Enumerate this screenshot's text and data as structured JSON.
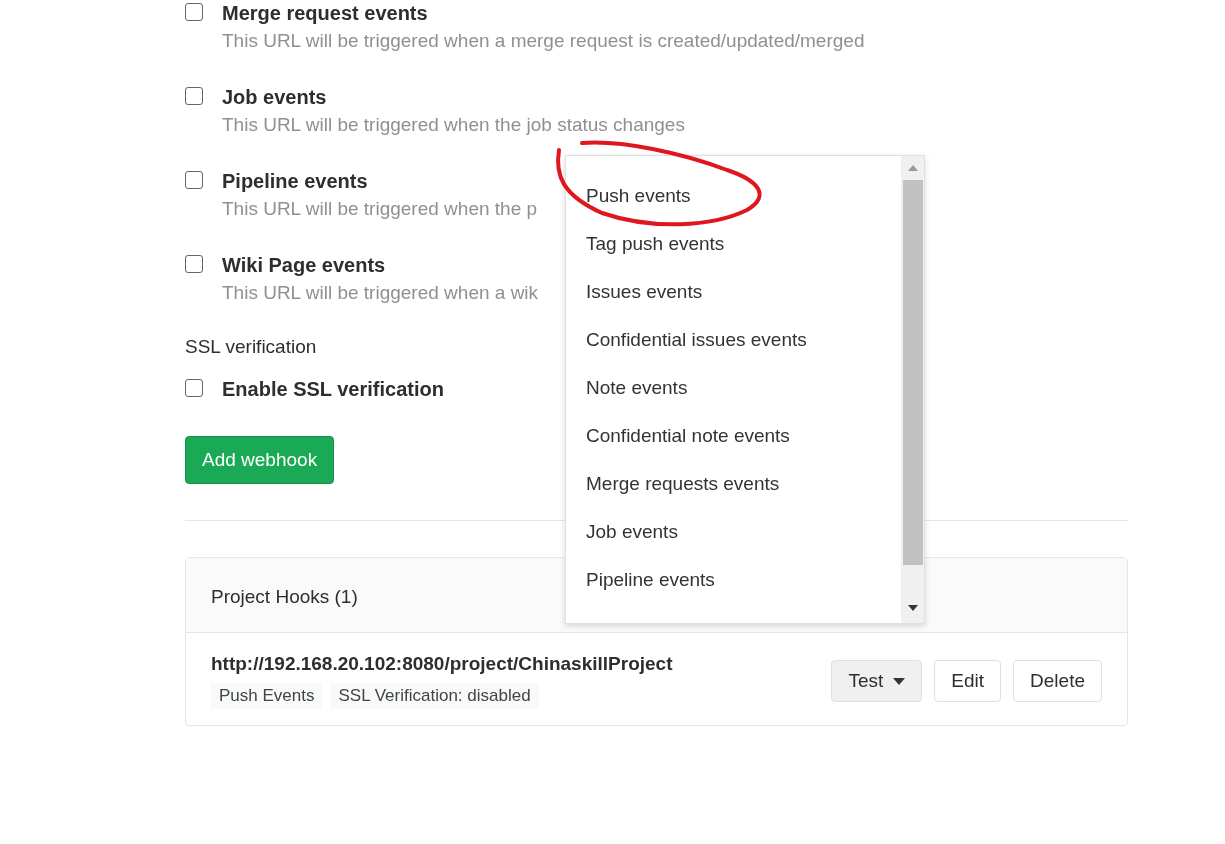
{
  "events": [
    {
      "label": "Merge request events",
      "description": "This URL will be triggered when a merge request is created/updated/merged",
      "checked": false
    },
    {
      "label": "Job events",
      "description": "This URL will be triggered when the job status changes",
      "checked": false
    },
    {
      "label": "Pipeline events",
      "description": "This URL will be triggered when the p",
      "checked": false
    },
    {
      "label": "Wiki Page events",
      "description": "This URL will be triggered when a wik",
      "checked": false
    }
  ],
  "ssl": {
    "heading": "SSL verification",
    "label": "Enable SSL verification",
    "checked": false
  },
  "submit_button": "Add webhook",
  "hooks": {
    "title": "Project Hooks (1)",
    "items": [
      {
        "url": "http://192.168.20.102:8080/project/ChinaskillProject",
        "badges": [
          "Push Events",
          "SSL Verification: disabled"
        ],
        "actions": [
          "Test",
          "Edit",
          "Delete"
        ]
      }
    ]
  },
  "dropdown": {
    "items": [
      "Push events",
      "Tag push events",
      "Issues events",
      "Confidential issues events",
      "Note events",
      "Confidential note events",
      "Merge requests events",
      "Job events",
      "Pipeline events"
    ]
  },
  "annotation": {
    "kind": "circle",
    "color": "#e0161e"
  }
}
